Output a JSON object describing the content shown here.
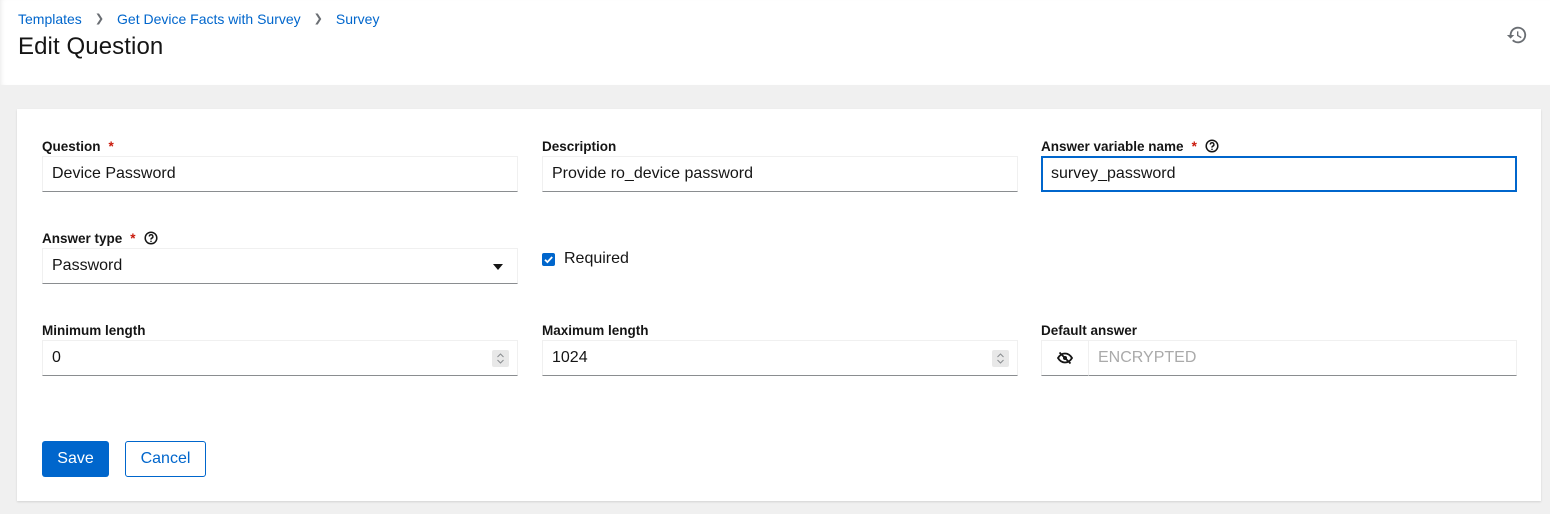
{
  "breadcrumb": {
    "items": [
      {
        "label": "Templates"
      },
      {
        "label": "Get Device Facts with Survey"
      },
      {
        "label": "Survey"
      }
    ]
  },
  "page": {
    "title": "Edit Question",
    "history_icon": "history-icon"
  },
  "form": {
    "question": {
      "label": "Question",
      "required_mark": "*",
      "value": "Device Password"
    },
    "description": {
      "label": "Description",
      "value": "Provide ro_device password"
    },
    "variable": {
      "label": "Answer variable name",
      "required_mark": "*",
      "value": "survey_password"
    },
    "answer_type": {
      "label": "Answer type",
      "required_mark": "*",
      "selected": "Password"
    },
    "required": {
      "label": "Required",
      "checked": true
    },
    "min_length": {
      "label": "Minimum length",
      "value": "0"
    },
    "max_length": {
      "label": "Maximum length",
      "value": "1024"
    },
    "default_answer": {
      "label": "Default answer",
      "placeholder": "ENCRYPTED",
      "toggle_icon": "eye-slash-icon"
    }
  },
  "actions": {
    "save_label": "Save",
    "cancel_label": "Cancel"
  },
  "colors": {
    "primary": "#0066cc",
    "required": "#c9190b"
  }
}
